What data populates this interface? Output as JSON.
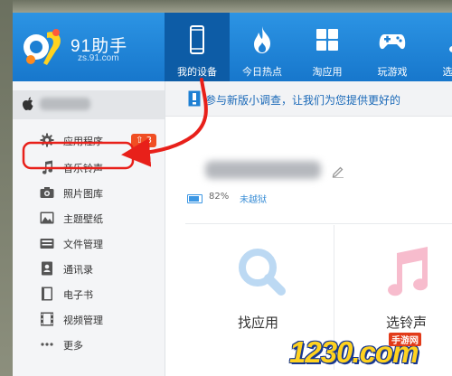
{
  "app": {
    "brand": "91助手",
    "brand_sub": "zs.91.com"
  },
  "colors": {
    "header": "#1777cc",
    "active_tab": "#0d5ca6",
    "badge": "#f04e23",
    "annotation": "#e8201a"
  },
  "tabs": [
    {
      "label": "我的设备",
      "icon": "phone-icon",
      "active": true
    },
    {
      "label": "今日热点",
      "icon": "flame-icon",
      "active": false
    },
    {
      "label": "淘应用",
      "icon": "apps-grid-icon",
      "active": false
    },
    {
      "label": "玩游戏",
      "icon": "gamepad-icon",
      "active": false
    },
    {
      "label": "选音乐",
      "icon": "music-note-icon",
      "active": false
    }
  ],
  "sidebar": {
    "device_icon": "apple-icon",
    "items": [
      {
        "label": "应用程序",
        "icon": "gear-icon",
        "badge": "3"
      },
      {
        "label": "音乐铃声",
        "icon": "music-note-icon"
      },
      {
        "label": "照片图库",
        "icon": "camera-icon"
      },
      {
        "label": "主题壁纸",
        "icon": "wallpaper-icon"
      },
      {
        "label": "文件管理",
        "icon": "folder-icon"
      },
      {
        "label": "通讯录",
        "icon": "contacts-icon"
      },
      {
        "label": "电子书",
        "icon": "book-icon"
      },
      {
        "label": "视频管理",
        "icon": "film-icon"
      },
      {
        "label": "更多",
        "icon": "more-dots-icon"
      }
    ]
  },
  "main": {
    "survey_text": "参与新版小调查，让我们为您提供更好的",
    "battery_percent": 0.82,
    "battery_text": "82%",
    "jailbreak_status": "未越狱",
    "cards": [
      {
        "label": "找应用",
        "icon": "search-icon"
      },
      {
        "label": "选铃声",
        "icon": "music-note-icon"
      }
    ]
  },
  "watermark": {
    "text": "1230.com",
    "sub": "手游网"
  }
}
